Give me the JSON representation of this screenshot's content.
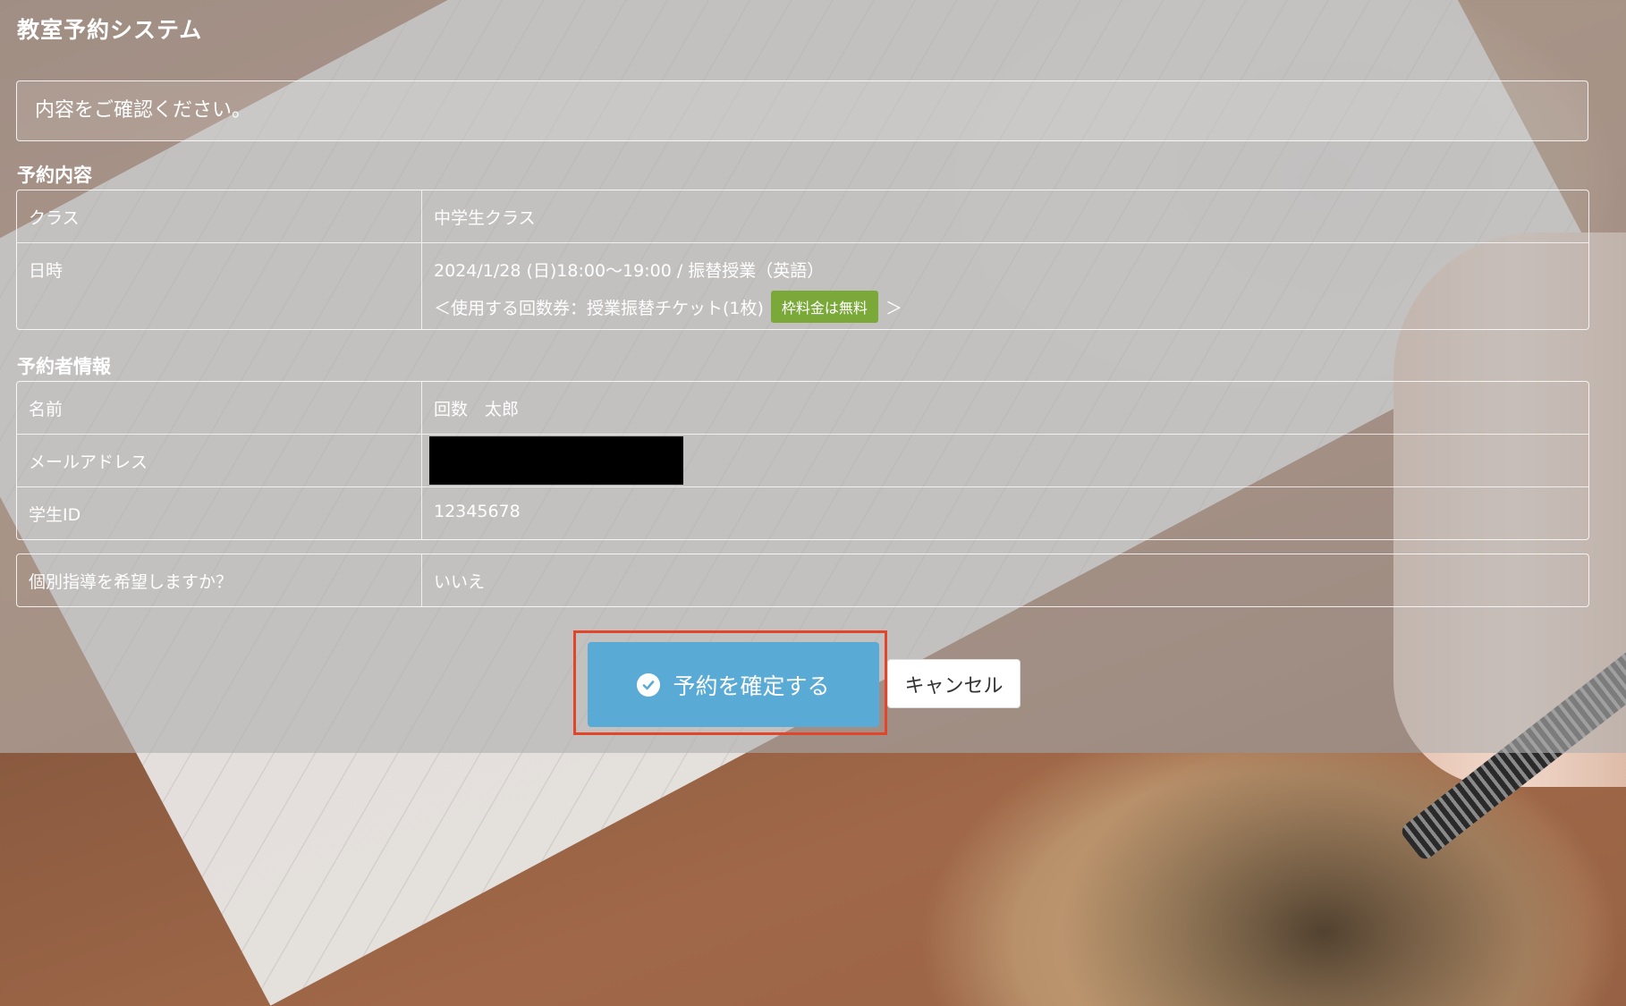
{
  "app": {
    "title": "教室予約システム"
  },
  "notice": {
    "text": "内容をご確認ください。"
  },
  "reservation": {
    "section_title": "予約内容",
    "rows": [
      {
        "label": "クラス",
        "value": "中学生クラス"
      },
      {
        "label": "日時",
        "value": "2024/1/28 (日)18:00〜19:00 / 振替授業（英語）",
        "ticket_prefix": "＜使用する回数券：授業振替チケット(1枚)",
        "badge": "枠料金は無料",
        "ticket_suffix": "＞"
      }
    ]
  },
  "booker": {
    "section_title": "予約者情報",
    "rows": [
      {
        "label": "名前",
        "value": "回数　太郎"
      },
      {
        "label": "メールアドレス",
        "value": ""
      },
      {
        "label": "学生ID",
        "value": "12345678"
      }
    ]
  },
  "extra": {
    "rows": [
      {
        "label": "個別指導を希望しますか？",
        "value": "いいえ"
      }
    ]
  },
  "actions": {
    "confirm_label": "予約を確定する",
    "cancel_label": "キャンセル"
  },
  "colors": {
    "confirm_button": "#5aaad6",
    "badge": "#7aa93a",
    "highlight_border": "#e2452a"
  },
  "icons": {
    "confirm": "check-circle-icon"
  }
}
